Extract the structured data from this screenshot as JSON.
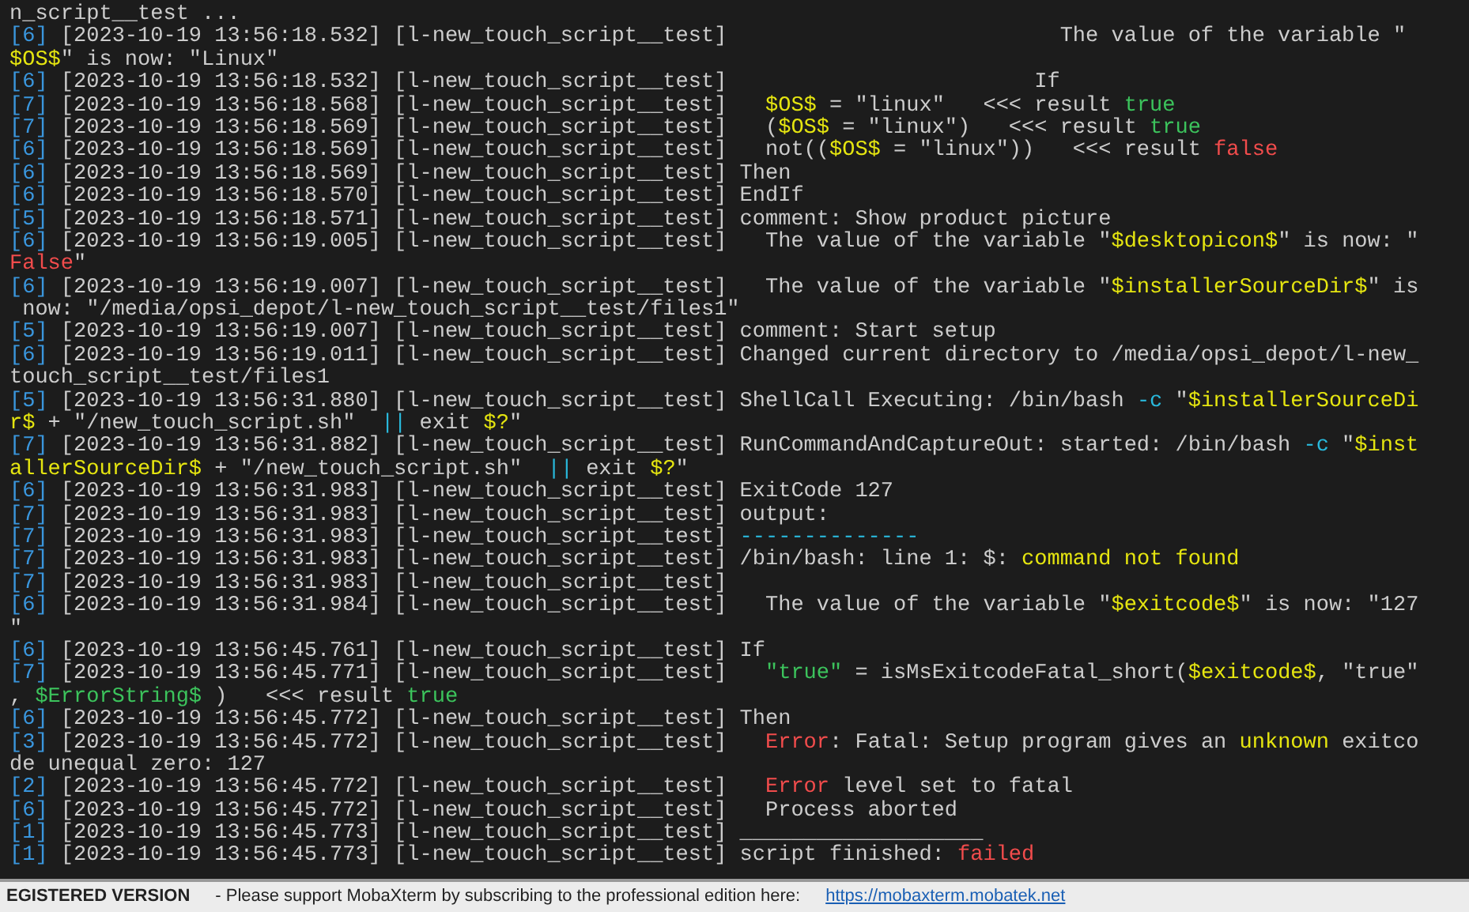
{
  "terminal": {
    "rows": [
      {
        "message": [
          {
            "kind": "plain",
            "text": "n_script__test ..."
          }
        ]
      },
      {
        "tag": "[6]",
        "stamp": "[2023-10-19 13:56:18.532]",
        "source": "[l-new_touch_script__test]",
        "message": [
          {
            "kind": "plain",
            "text": "                          The value of the variable \""
          }
        ]
      },
      {
        "message": [
          {
            "kind": "var",
            "text": "$OS$"
          },
          {
            "kind": "plain",
            "text": "\" is now: \"Linux\""
          }
        ]
      },
      {
        "tag": "[6]",
        "stamp": "[2023-10-19 13:56:18.532]",
        "source": "[l-new_touch_script__test]",
        "message": [
          {
            "kind": "plain",
            "text": "                        If"
          }
        ]
      },
      {
        "tag": "[7]",
        "stamp": "[2023-10-19 13:56:18.568]",
        "source": "[l-new_touch_script__test]   ",
        "message": [
          {
            "kind": "var",
            "text": "$OS$"
          },
          {
            "kind": "plain",
            "text": " = \"linux\"   <<< result "
          },
          {
            "kind": "ok",
            "text": "true"
          }
        ]
      },
      {
        "tag": "[7]",
        "stamp": "[2023-10-19 13:56:18.569]",
        "source": "[l-new_touch_script__test]",
        "message": [
          {
            "kind": "plain",
            "text": "   ("
          },
          {
            "kind": "var",
            "text": "$OS$"
          },
          {
            "kind": "plain",
            "text": " = \"linux\")   <<< result "
          },
          {
            "kind": "ok",
            "text": "true"
          }
        ]
      },
      {
        "tag": "[6]",
        "stamp": "[2023-10-19 13:56:18.569]",
        "source": "[l-new_touch_script__test]",
        "message": [
          {
            "kind": "plain",
            "text": "   not(("
          },
          {
            "kind": "var",
            "text": "$OS$"
          },
          {
            "kind": "plain",
            "text": " = \"linux\"))   <<< result "
          },
          {
            "kind": "error",
            "text": "false"
          }
        ]
      },
      {
        "tag": "[6]",
        "stamp": "[2023-10-19 13:56:18.569]",
        "source": "[l-new_touch_script__test]",
        "message": [
          {
            "kind": "plain",
            "text": " Then"
          }
        ]
      },
      {
        "tag": "[6]",
        "stamp": "[2023-10-19 13:56:18.570]",
        "source": "[l-new_touch_script__test]",
        "message": [
          {
            "kind": "plain",
            "text": " EndIf"
          }
        ]
      },
      {
        "tag": "[5]",
        "stamp": "[2023-10-19 13:56:18.571]",
        "source": "[l-new_touch_script__test]",
        "message": [
          {
            "kind": "plain",
            "text": " comment: Show product picture"
          }
        ]
      },
      {
        "tag": "[6]",
        "stamp": "[2023-10-19 13:56:19.005]",
        "source": "[l-new_touch_script__test]",
        "message": [
          {
            "kind": "plain",
            "text": "   The value of the variable \""
          },
          {
            "kind": "var",
            "text": "$desktopicon$"
          },
          {
            "kind": "plain",
            "text": "\" is now: \""
          }
        ]
      },
      {
        "message": [
          {
            "kind": "error",
            "text": "False"
          },
          {
            "kind": "plain",
            "text": "\""
          }
        ]
      },
      {
        "tag": "[6]",
        "stamp": "[2023-10-19 13:56:19.007]",
        "source": "[l-new_touch_script__test]",
        "message": [
          {
            "kind": "plain",
            "text": "   The value of the variable \""
          },
          {
            "kind": "var",
            "text": "$installerSourceDir$"
          },
          {
            "kind": "plain",
            "text": "\" is"
          }
        ]
      },
      {
        "message": [
          {
            "kind": "plain",
            "text": " now: \"/media/opsi_depot/l-new_touch_script__test/files1\""
          }
        ]
      },
      {
        "tag": "[5]",
        "stamp": "[2023-10-19 13:56:19.007]",
        "source": "[l-new_touch_script__test]",
        "message": [
          {
            "kind": "plain",
            "text": " comment: Start setup"
          }
        ]
      },
      {
        "tag": "[6]",
        "stamp": "[2023-10-19 13:56:19.011]",
        "source": "[l-new_touch_script__test]",
        "message": [
          {
            "kind": "plain",
            "text": " Changed current directory to /media/opsi_depot/l-new_"
          }
        ]
      },
      {
        "message": [
          {
            "kind": "plain",
            "text": "touch_script__test/files1"
          }
        ]
      },
      {
        "tag": "[5]",
        "stamp": "[2023-10-19 13:56:31.880]",
        "source": "[l-new_touch_script__test]",
        "message": [
          {
            "kind": "plain",
            "text": " ShellCall Executing: /bin/bash "
          },
          {
            "kind": "operator",
            "text": "-c"
          },
          {
            "kind": "plain",
            "text": " \""
          },
          {
            "kind": "var",
            "text": "$installerSourceDi"
          }
        ]
      },
      {
        "message": [
          {
            "kind": "var",
            "text": "r$"
          },
          {
            "kind": "plain",
            "text": " + \"/new_touch_script.sh\"  "
          },
          {
            "kind": "operator",
            "text": "||"
          },
          {
            "kind": "plain",
            "text": " exit "
          },
          {
            "kind": "var",
            "text": "$?"
          },
          {
            "kind": "plain",
            "text": "\""
          }
        ]
      },
      {
        "tag": "[7]",
        "stamp": "[2023-10-19 13:56:31.882]",
        "source": "[l-new_touch_script__test]",
        "message": [
          {
            "kind": "plain",
            "text": " RunCommandAndCaptureOut: started: /bin/bash "
          },
          {
            "kind": "operator",
            "text": "-c"
          },
          {
            "kind": "plain",
            "text": " \""
          },
          {
            "kind": "var",
            "text": "$inst"
          }
        ]
      },
      {
        "message": [
          {
            "kind": "var",
            "text": "allerSourceDir$"
          },
          {
            "kind": "plain",
            "text": " + \"/new_touch_script.sh\"  "
          },
          {
            "kind": "operator",
            "text": "||"
          },
          {
            "kind": "plain",
            "text": " exit "
          },
          {
            "kind": "var",
            "text": "$?"
          },
          {
            "kind": "plain",
            "text": "\""
          }
        ]
      },
      {
        "tag": "[6]",
        "stamp": "[2023-10-19 13:56:31.983]",
        "source": "[l-new_touch_script__test]",
        "message": [
          {
            "kind": "plain",
            "text": " ExitCode 127"
          }
        ]
      },
      {
        "tag": "[7]",
        "stamp": "[2023-10-19 13:56:31.983]",
        "source": "[l-new_touch_script__test]",
        "message": [
          {
            "kind": "plain",
            "text": " output:"
          }
        ]
      },
      {
        "tag": "[7]",
        "stamp": "[2023-10-19 13:56:31.983]",
        "source": "[l-new_touch_script__test] ",
        "message": [
          {
            "kind": "operator",
            "text": "--------------"
          }
        ]
      },
      {
        "tag": "[7]",
        "stamp": "[2023-10-19 13:56:31.983]",
        "source": "[l-new_touch_script__test]",
        "message": [
          {
            "kind": "plain",
            "text": " /bin/bash: line 1: $: "
          },
          {
            "kind": "var",
            "text": "command not found"
          }
        ]
      },
      {
        "tag": "[7]",
        "stamp": "[2023-10-19 13:56:31.983]",
        "source": "[l-new_touch_script__test]"
      },
      {
        "tag": "[6]",
        "stamp": "[2023-10-19 13:56:31.984]",
        "source": "[l-new_touch_script__test]",
        "message": [
          {
            "kind": "plain",
            "text": "   The value of the variable \""
          },
          {
            "kind": "var",
            "text": "$exitcode$"
          },
          {
            "kind": "plain",
            "text": "\" is now: \"127"
          }
        ]
      },
      {
        "message": [
          {
            "kind": "plain",
            "text": "\""
          }
        ]
      },
      {
        "tag": "[6]",
        "stamp": "[2023-10-19 13:56:45.761]",
        "source": "[l-new_touch_script__test]",
        "message": [
          {
            "kind": "plain",
            "text": " If"
          }
        ]
      },
      {
        "tag": "[7]",
        "stamp": "[2023-10-19 13:56:45.771]",
        "source": "[l-new_touch_script__test]   ",
        "message": [
          {
            "kind": "ok",
            "text": "\"true\""
          },
          {
            "kind": "plain",
            "text": " = isMsExitcodeFatal_short("
          },
          {
            "kind": "var",
            "text": "$exitcode$"
          },
          {
            "kind": "plain",
            "text": ", \"true\""
          }
        ]
      },
      {
        "message": [
          {
            "kind": "plain",
            "text": ", "
          },
          {
            "kind": "ok",
            "text": "$ErrorString$"
          },
          {
            "kind": "plain",
            "text": " )   <<< result "
          },
          {
            "kind": "ok",
            "text": "true"
          }
        ]
      },
      {
        "tag": "[6]",
        "stamp": "[2023-10-19 13:56:45.772]",
        "source": "[l-new_touch_script__test]",
        "message": [
          {
            "kind": "plain",
            "text": " Then"
          }
        ]
      },
      {
        "tag": "[3]",
        "stamp": "[2023-10-19 13:56:45.772]",
        "source": "[l-new_touch_script__test]   ",
        "message": [
          {
            "kind": "error",
            "text": "Error"
          },
          {
            "kind": "plain",
            "text": ": Fatal: Setup program gives an "
          },
          {
            "kind": "var",
            "text": "unknown"
          },
          {
            "kind": "plain",
            "text": " exitco"
          }
        ]
      },
      {
        "message": [
          {
            "kind": "plain",
            "text": "de unequal zero: 127"
          }
        ]
      },
      {
        "tag": "[2]",
        "stamp": "[2023-10-19 13:56:45.772]",
        "source": "[l-new_touch_script__test]   ",
        "message": [
          {
            "kind": "error",
            "text": "Error"
          },
          {
            "kind": "plain",
            "text": " level set to fatal"
          }
        ]
      },
      {
        "tag": "[6]",
        "stamp": "[2023-10-19 13:56:45.772]",
        "source": "[l-new_touch_script__test]",
        "message": [
          {
            "kind": "plain",
            "text": "   Process aborted"
          }
        ]
      },
      {
        "tag": "[1]",
        "stamp": "[2023-10-19 13:56:45.773]",
        "source": "[l-new_touch_script__test]",
        "message": [
          {
            "kind": "plain",
            "text": " ___________________"
          }
        ]
      },
      {
        "tag": "[1]",
        "stamp": "[2023-10-19 13:56:45.773]",
        "source": "[l-new_touch_script__test]",
        "message": [
          {
            "kind": "plain",
            "text": " script finished: "
          },
          {
            "kind": "error",
            "text": "failed"
          }
        ]
      }
    ]
  },
  "status_bar": {
    "label": "EGISTERED VERSION",
    "message": "-   Please support MobaXterm by subscribing to the professional edition here:",
    "link": "https://mobaxterm.mobatek.net"
  }
}
